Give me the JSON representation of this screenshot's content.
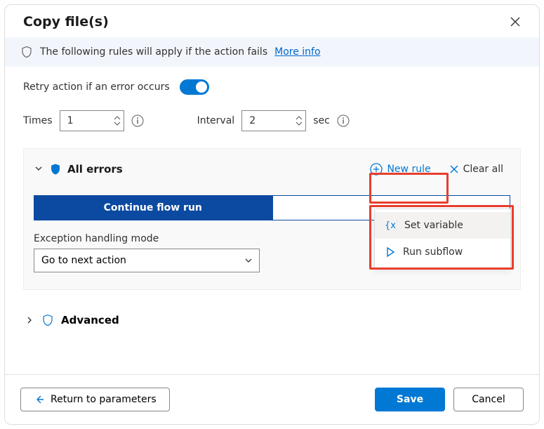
{
  "title": "Copy file(s)",
  "info": {
    "text": "The following rules will apply if the action fails",
    "link": "More info"
  },
  "retry": {
    "label": "Retry action if an error occurs",
    "on": true,
    "times_label": "Times",
    "times_value": "1",
    "interval_label": "Interval",
    "interval_value": "2",
    "interval_unit": "sec"
  },
  "errors": {
    "heading": "All errors",
    "new_rule": "New rule",
    "clear_all": "Clear all",
    "segment_active": "Continue flow run",
    "segment_inactive": "",
    "mode_label": "Exception handling mode",
    "mode_value": "Go to next action"
  },
  "menu": {
    "set_variable": "Set variable",
    "run_subflow": "Run subflow"
  },
  "advanced": "Advanced",
  "footer": {
    "back": "Return to parameters",
    "save": "Save",
    "cancel": "Cancel"
  }
}
